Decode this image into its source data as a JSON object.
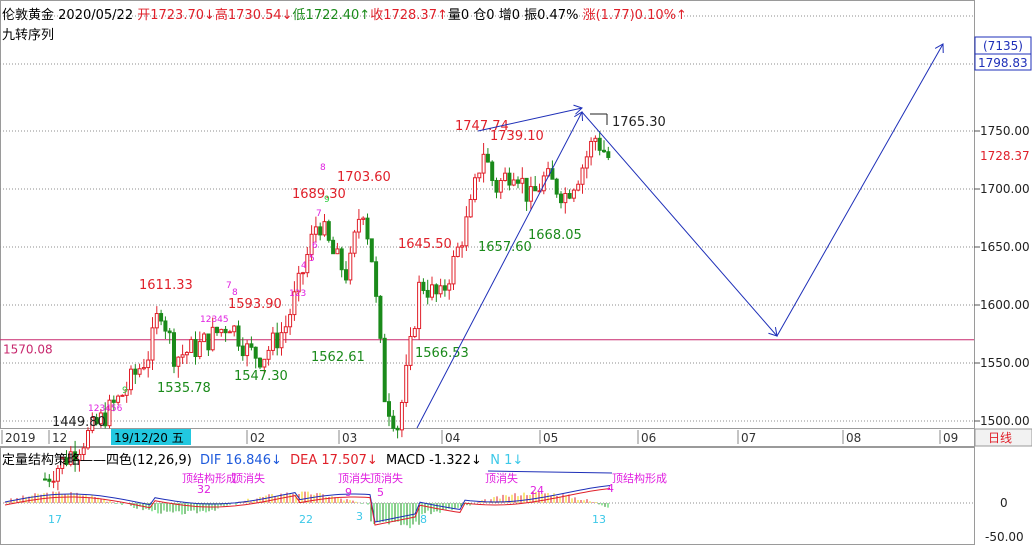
{
  "header": {
    "instrument": "伦敦黄金",
    "date": "2020/05/22",
    "open": "开1723.70↓",
    "high": "高1730.54↓",
    "low": "低1722.40↑",
    "close": "收1728.37↑",
    "volume": "量0",
    "position": "仓0",
    "increase": "增0",
    "amplitude": "振0.47%",
    "change": "涨(1.77)0.10%↑"
  },
  "subtitle": "九转序列",
  "indicator": {
    "name": "定量结构策略——四色(12,26,9)",
    "dif": "DIF 16.846↓",
    "dea": "DEA 17.507↓",
    "macd": "MACD -1.322↓",
    "n": "N 1↓",
    "markers": [
      {
        "text": "17",
        "x": 48,
        "y": 523,
        "color": "#3cc8e8"
      },
      {
        "text": "22",
        "x": 299,
        "y": 523,
        "color": "#3cc8e8"
      },
      {
        "text": "3",
        "x": 356,
        "y": 520,
        "color": "#3cc8e8"
      },
      {
        "text": "8",
        "x": 420,
        "y": 523,
        "color": "#3cc8e8"
      },
      {
        "text": "13",
        "x": 592,
        "y": 523,
        "color": "#3cc8e8"
      },
      {
        "text": "32",
        "x": 197,
        "y": 493,
        "color": "#e020e0"
      },
      {
        "text": "24",
        "x": 530,
        "y": 494,
        "color": "#e020e0"
      },
      {
        "text": "9",
        "x": 345,
        "y": 496,
        "color": "#e020e0"
      },
      {
        "text": "5",
        "x": 377,
        "y": 496,
        "color": "#e020e0"
      },
      {
        "text": "顶结构形成",
        "x": 182,
        "y": 482,
        "color": "#e020e0"
      },
      {
        "text": "顶消失",
        "x": 232,
        "y": 482,
        "color": "#e020e0"
      },
      {
        "text": "顶消失",
        "x": 338,
        "y": 482,
        "color": "#e020e0"
      },
      {
        "text": "顶消失",
        "x": 370,
        "y": 482,
        "color": "#e020e0"
      },
      {
        "text": "顶消失",
        "x": 485,
        "y": 482,
        "color": "#e020e0"
      },
      {
        "text": "顶结构形成",
        "x": 612,
        "y": 482,
        "color": "#e020e0"
      },
      {
        "text": "4",
        "x": 607,
        "y": 492,
        "color": "#e020e0"
      }
    ]
  },
  "price_scale": {
    "labels": [
      "1750.00",
      "1700.00",
      "1650.00",
      "1600.00",
      "1550.00",
      "1500.00"
    ],
    "current_price": "1728.37",
    "target_label": "(7135)",
    "target_price": "1798.83",
    "support_price": "1570.08"
  },
  "time_axis": {
    "labels": [
      "2019",
      "12",
      "02",
      "03",
      "04",
      "05",
      "06",
      "07",
      "08",
      "09"
    ],
    "cursor_date": "19/12/20 五",
    "period": "日线"
  },
  "sub_scale": {
    "labels": [
      "0",
      "-50.00"
    ]
  },
  "chart_data": {
    "type": "candlestick",
    "ylim": [
      1495,
      1805
    ],
    "annotations": [
      {
        "text": "1449.80",
        "value": 1449.8
      },
      {
        "text": "1611.33",
        "value": 1611.33
      },
      {
        "text": "1535.78",
        "value": 1535.78
      },
      {
        "text": "1593.90",
        "value": 1593.9
      },
      {
        "text": "1547.30",
        "value": 1547.3
      },
      {
        "text": "1689.30",
        "value": 1689.3
      },
      {
        "text": "1703.60",
        "value": 1703.6
      },
      {
        "text": "1562.61",
        "value": 1562.61
      },
      {
        "text": "1645.50",
        "value": 1645.5
      },
      {
        "text": "1566.53",
        "value": 1566.53
      },
      {
        "text": "1747.74",
        "value": 1747.74
      },
      {
        "text": "1739.10",
        "value": 1739.1
      },
      {
        "text": "1657.60",
        "value": 1657.6
      },
      {
        "text": "1668.05",
        "value": 1668.05
      },
      {
        "text": "1765.30",
        "value": 1765.3
      }
    ],
    "nine_turn_labels": [
      {
        "text": "9",
        "color": "#2ecc40"
      },
      {
        "text": "123456",
        "color": "#e020e0"
      },
      {
        "text": "12345",
        "color": "#e020e0"
      },
      {
        "text": "7",
        "color": "#e020e0"
      },
      {
        "text": "8",
        "color": "#e020e0"
      },
      {
        "text": "123",
        "color": "#e020e0"
      },
      {
        "text": "4",
        "color": "#e020e0"
      },
      {
        "text": "5",
        "color": "#e020e0"
      },
      {
        "text": "6",
        "color": "#e020e0"
      },
      {
        "text": "7",
        "color": "#e020e0"
      },
      {
        "text": "8",
        "color": "#e020e0"
      },
      {
        "text": "9",
        "color": "#2ecc40"
      }
    ],
    "projection": [
      {
        "date": "2020-03-20",
        "value": 1495
      },
      {
        "date": "2020-05-18",
        "value": 1765
      },
      {
        "date": "2020-07-10",
        "value": 1572
      },
      {
        "date": "2020-09-10",
        "value": 1798.83
      }
    ],
    "colors": {
      "up": "#e0202a",
      "down": "#1a8a1a",
      "arrow": "#1e2fb8",
      "support": "#c8286e"
    }
  }
}
